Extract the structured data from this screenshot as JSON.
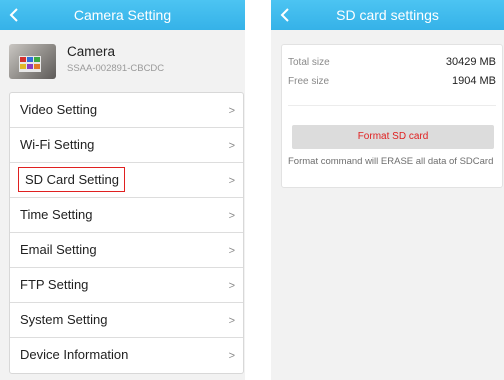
{
  "camera_setting": {
    "title": "Camera Setting",
    "camera": {
      "name": "Camera",
      "id": "SSAA-002891-CBCDC"
    },
    "menu": [
      {
        "label": "Video Setting"
      },
      {
        "label": "Wi-Fi Setting"
      },
      {
        "label": "SD Card Setting",
        "highlighted": true
      },
      {
        "label": "Time Setting"
      },
      {
        "label": "Email Setting"
      },
      {
        "label": "FTP Setting"
      },
      {
        "label": "System Setting"
      },
      {
        "label": "Device Information"
      }
    ],
    "chevron": ">"
  },
  "sd_card_settings": {
    "title": "SD card settings",
    "total_label": "Total size",
    "total_value": "30429 MB",
    "free_label": "Free size",
    "free_value": "1904 MB",
    "format_button": "Format SD card",
    "format_note": "Format command will ERASE all data of SDCard"
  },
  "colors": {
    "topbar": "#3bb7ec",
    "highlight_border": "#e02020",
    "format_text": "#e02020"
  },
  "icons": {
    "back": "chevron-left-icon",
    "menu_arrow": "chevron-right-icon"
  }
}
